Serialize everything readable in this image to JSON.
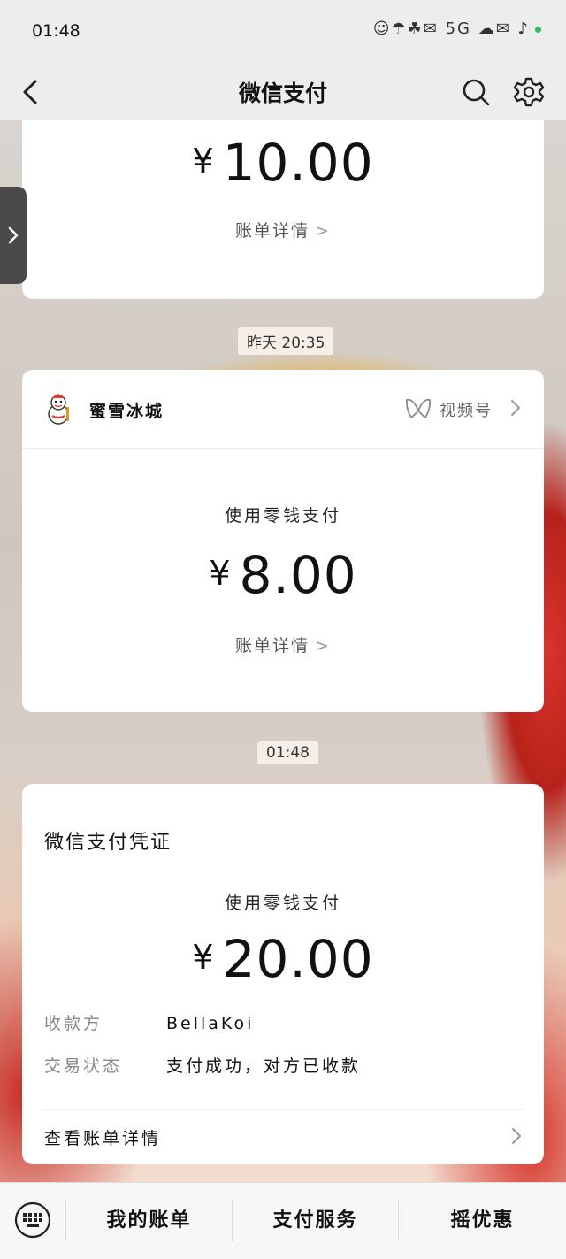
{
  "status": {
    "time": "01:48",
    "icons": "☺☂☘✉ 5G ☁✉ ♪"
  },
  "nav": {
    "title": "微信支付"
  },
  "card1": {
    "amount": "10.00",
    "currency": "¥",
    "detail": "账单详情"
  },
  "tag1": {
    "text": "昨天 20:35"
  },
  "card2": {
    "merchant": "蜜雪冰城",
    "channel": "视频号",
    "method": "使用零钱支付",
    "amount": "8.00",
    "currency": "¥",
    "detail": "账单详情"
  },
  "tag2": {
    "text": "01:48"
  },
  "card3": {
    "title": "微信支付凭证",
    "method": "使用零钱支付",
    "amount": "20.00",
    "currency": "¥",
    "payee_label": "收款方",
    "payee_value": "BellaKoi",
    "status_label": "交易状态",
    "status_value": "支付成功，对方已收款",
    "view_bill": "查看账单详情"
  },
  "bottom": {
    "tab1": "我的账单",
    "tab2": "支付服务",
    "tab3": "摇优惠"
  }
}
